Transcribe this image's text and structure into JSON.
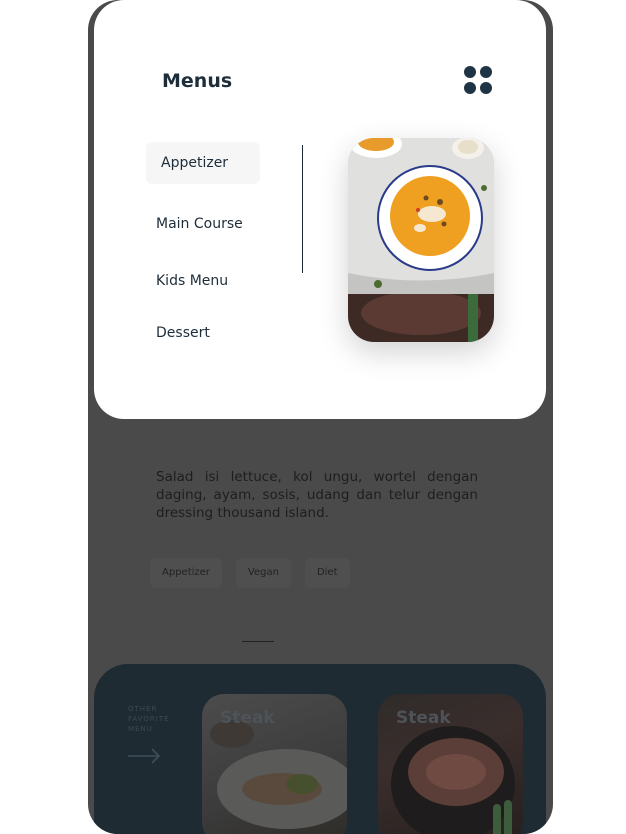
{
  "header": {
    "title": "Menus"
  },
  "menu": {
    "items": [
      {
        "label": "Appetizer"
      },
      {
        "label": "Main Course"
      },
      {
        "label": "Kids Menu"
      },
      {
        "label": "Dessert"
      }
    ]
  },
  "detail": {
    "description": "Salad isi lettuce, kol ungu, wortel dengan daging, ayam, sosis, udang dan telur dengan dressing thousand island.",
    "tags": [
      "Appetizer",
      "Vegan",
      "Diet"
    ]
  },
  "favorites": {
    "label": "OTHER FAVORITE MENU",
    "cards": [
      {
        "title": "Steak"
      },
      {
        "title": "Steak"
      }
    ]
  },
  "colors": {
    "primary": "#1d2d3a",
    "overlay": "#4a4a4a",
    "favorites_bg": "#1f2b33",
    "soup": "#f0a020"
  }
}
